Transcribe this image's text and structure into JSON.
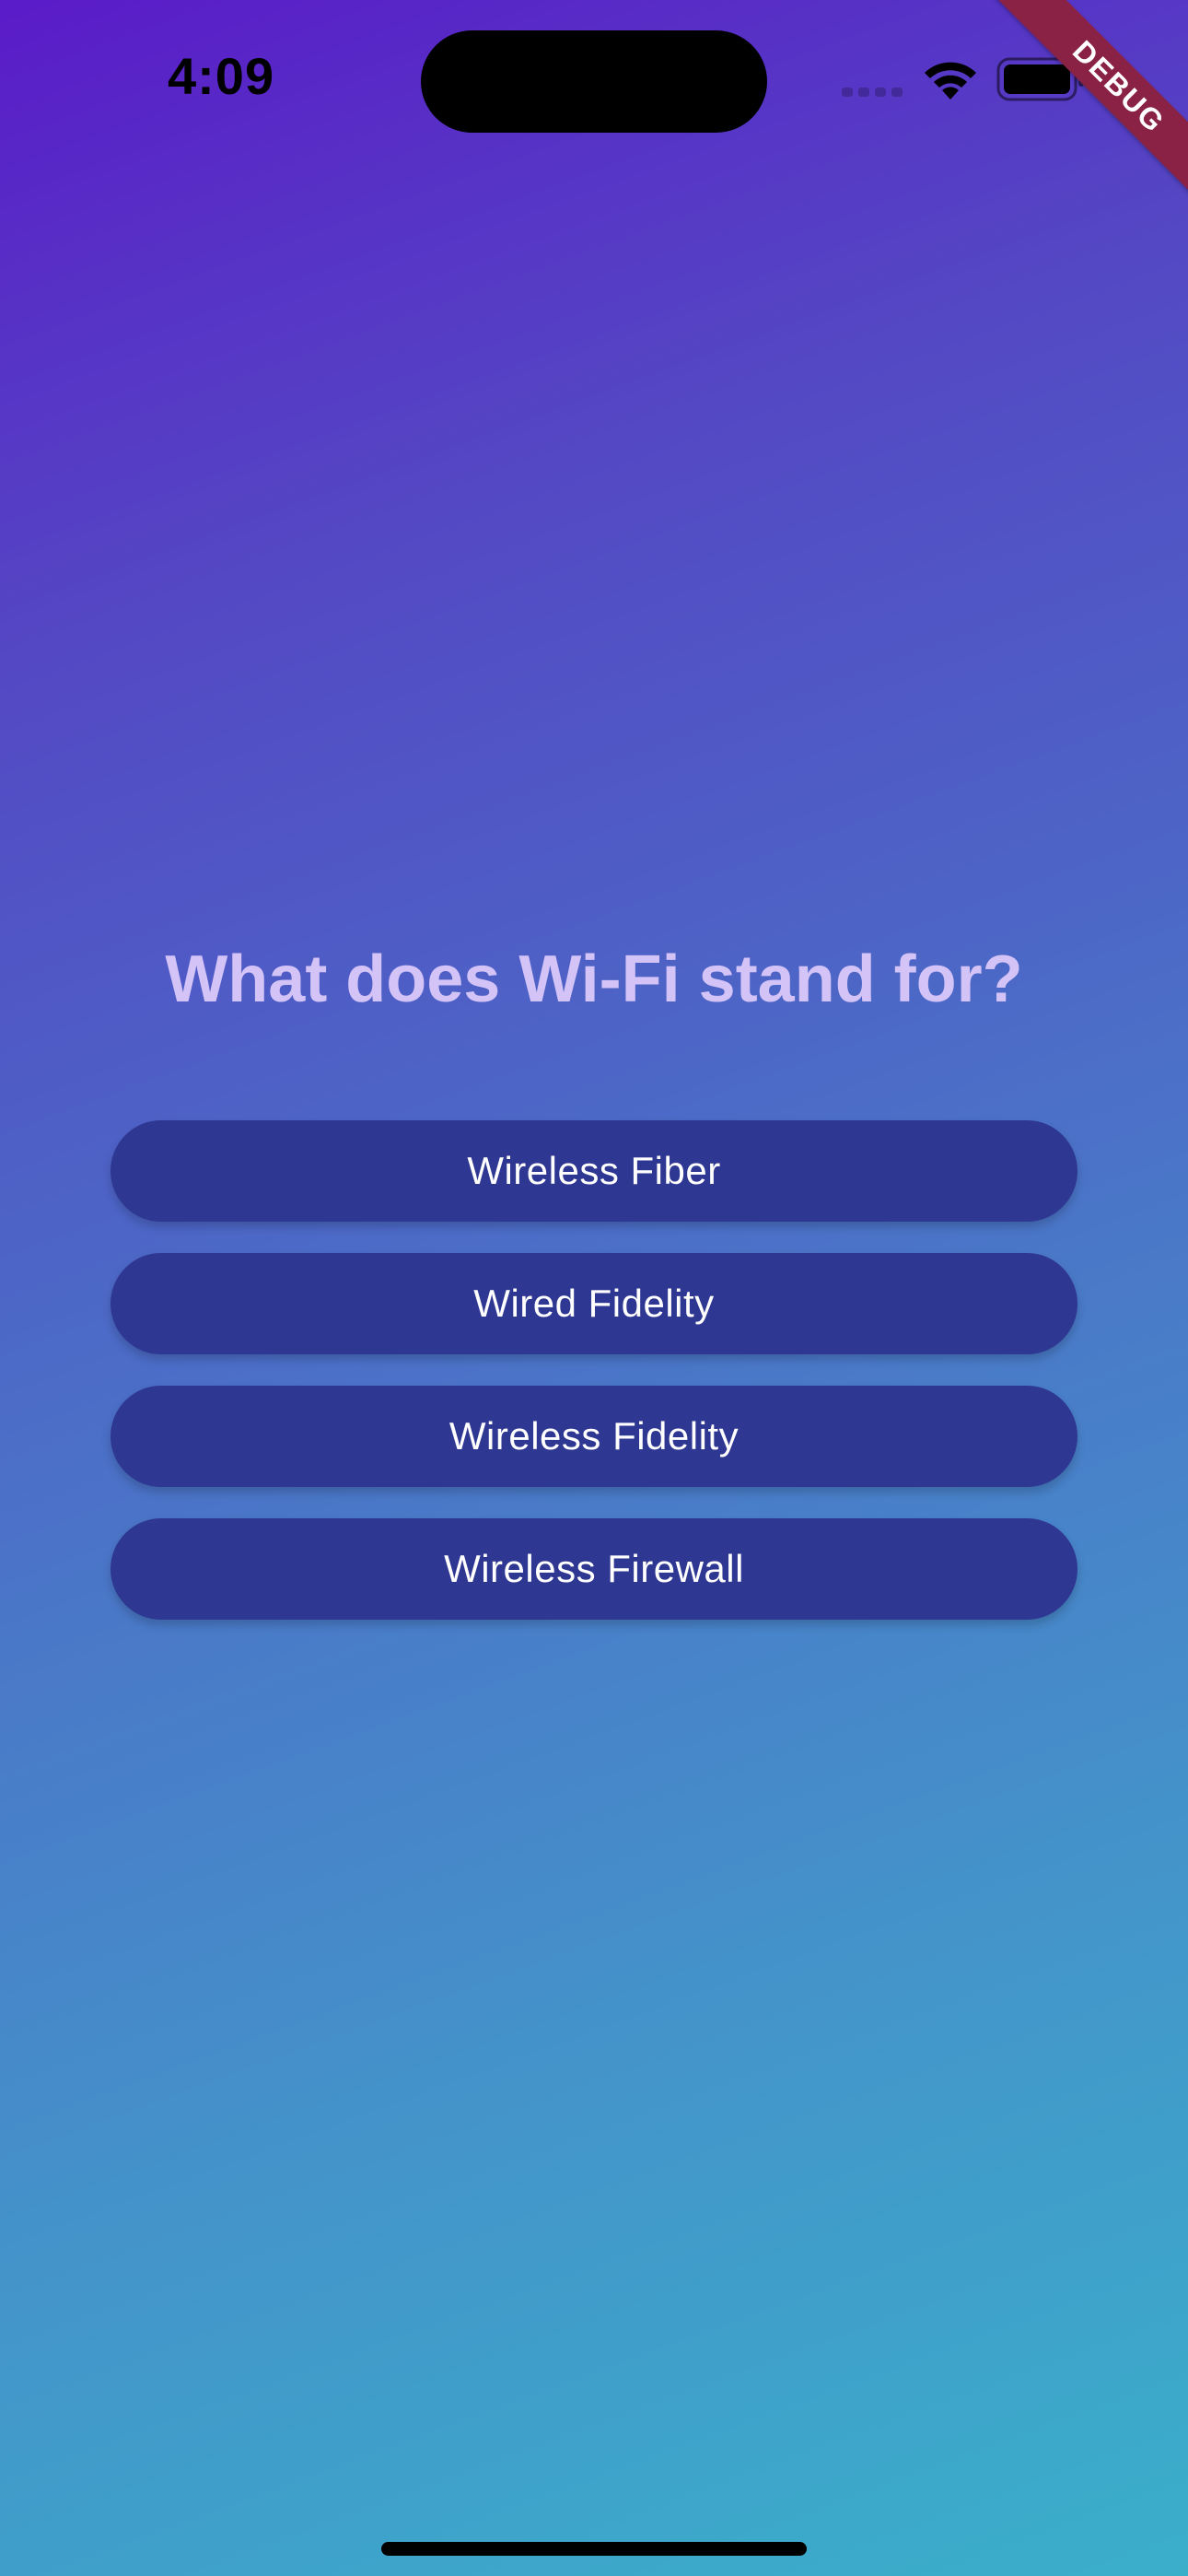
{
  "status_bar": {
    "time": "4:09",
    "icons": [
      "signal-icon",
      "wifi-icon",
      "battery-icon"
    ]
  },
  "debug_banner": {
    "label": "DEBUG",
    "color": "#8a2245"
  },
  "quiz": {
    "question": "What does Wi-Fi stand for?",
    "answers": [
      "Wireless Fiber",
      "Wired Fidelity",
      "Wireless Fidelity",
      "Wireless Firewall"
    ]
  },
  "colors": {
    "gradient_start": "#5a1bc8",
    "gradient_end": "#3aafca",
    "question_text": "#d3c3f7",
    "answer_button": "#2e3792",
    "answer_text": "#ffffff"
  }
}
